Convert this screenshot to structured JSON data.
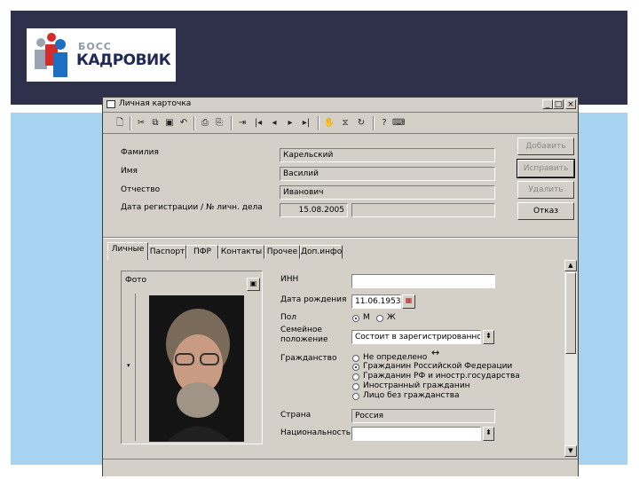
{
  "logo": {
    "small_text": "БОСС",
    "name": "КАДРОВИК"
  },
  "window": {
    "title": "Личная карточка",
    "minimize": "_",
    "maximize": "□",
    "close": "×"
  },
  "toolbar": {
    "icons": [
      "new-doc-icon",
      "cut-icon",
      "copy-icon",
      "save-icon",
      "undo-icon",
      "print-icon",
      "preview-icon",
      "import-icon",
      "first-record-icon",
      "prev-record-icon",
      "next-record-icon",
      "last-record-icon",
      "hand-icon",
      "filter-icon",
      "refresh-icon",
      "help-icon",
      "tooltip-icon"
    ]
  },
  "header_form": {
    "surname_label": "Фамилия",
    "surname_value": "Карельский",
    "name_label": "Имя",
    "name_value": "Василий",
    "patronymic_label": "Отчество",
    "patronymic_value": "Иванович",
    "regdate_label": "Дата регистрации / № личн. дела",
    "regdate_value": "15.08.2005",
    "file_number_value": ""
  },
  "buttons": {
    "add": "Добавить",
    "edit": "Исправить",
    "delete": "Удалить",
    "cancel": "Отказ"
  },
  "tabs": [
    "Личные",
    "Паспорт",
    "ПФР",
    "Контакты",
    "Прочее",
    "Доп.инфо"
  ],
  "photo": {
    "label": "Фото"
  },
  "personal": {
    "inn_label": "ИНН",
    "inn_value": "",
    "birth_label": "Дата рождения",
    "birth_value": "11.06.1953",
    "sex_label": "Пол",
    "sex_m": "М",
    "sex_f": "Ж",
    "sex_selected": "М",
    "marital_label": "Семейное положение",
    "marital_value": "Состоит в зарегистрированном б",
    "citizenship_label": "Гражданство",
    "citizenship_options": [
      "Не определено",
      "Гражданин Российской Федерации",
      "Гражданин РФ и иностр.государства",
      "Иностранный гражданин",
      "Лицо без гражданства"
    ],
    "citizenship_selected": "Гражданин Российской Федерации",
    "country_label": "Страна",
    "country_value": "Россия",
    "nationality_label": "Национальность",
    "nationality_value": ""
  }
}
